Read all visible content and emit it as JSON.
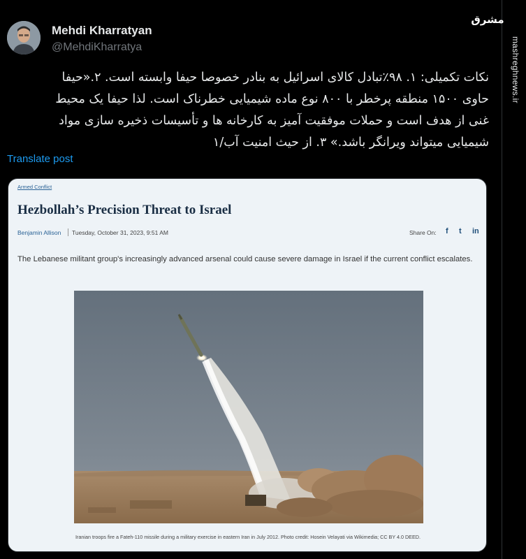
{
  "author": {
    "name": "Mehdi Kharratyan",
    "handle": "@MehdiKharratya"
  },
  "tweet": {
    "lines": [
      "نکات تکمیلی: ۱. ۹۸٪تبادل کالای اسرائیل به بنادر خصوصا حیفا وابسته است. ۲.«حیفا",
      "حاوی ۱۵۰۰ منطقه پرخطر با ۸۰۰ نوع ماده شیمیایی خطرناک است. لذا حیفا یک محیط",
      "غنی از هدف است و حملات موفقیت آمیز به کارخانه ها و تأسیسات ذخیره سازی مواد",
      "شیمیایی میتواند ویرانگر باشد.» ۳. از حیث امنیت آب/۱"
    ],
    "translate_label": "Translate post"
  },
  "embedded_article": {
    "tag": "Armed Conflict",
    "title": "Hezbollah’s Precision Threat to Israel",
    "author": "Benjamin Allison",
    "date": "Tuesday, October 31, 2023, 9:51 AM",
    "share_label": "Share On:",
    "share_icons": [
      "facebook-icon",
      "twitter-icon",
      "linkedin-icon"
    ],
    "share_glyphs": {
      "facebook": "f",
      "twitter": "t",
      "linkedin": "in"
    },
    "summary": "The Lebanese militant group's increasingly advanced arsenal could cause severe damage in Israel if the current conflict escalates.",
    "caption": "Iranian troops fire a Fateh-110 missile during a military exercise in eastern Iran in July 2012. Photo credit: Hosein Velayati via Wikimedia; CC BY 4.0 DEED."
  },
  "watermark": {
    "logo_text": "مشرق",
    "site_text": "mashreghnews.ir"
  },
  "colors": {
    "background": "#000000",
    "link_blue": "#1d9bf0",
    "text_primary": "#e7e9ea",
    "text_secondary": "#71767b",
    "card_background": "#eef3f7",
    "article_title": "#1a2e44"
  }
}
